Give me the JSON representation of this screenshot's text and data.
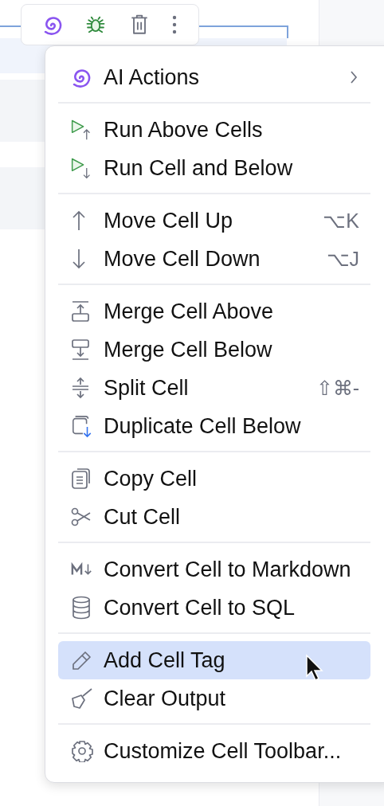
{
  "toolbar": {
    "buttons": [
      {
        "kind": "ai"
      },
      {
        "kind": "debug"
      },
      {
        "kind": "delete"
      },
      {
        "kind": "more"
      }
    ]
  },
  "menu": {
    "groups": [
      [
        {
          "kind": "ai",
          "label": "AI Actions",
          "submenu": true,
          "selected": false
        }
      ],
      [
        {
          "kind": "run-above",
          "label": "Run Above Cells",
          "submenu": false,
          "selected": false
        },
        {
          "kind": "run-below",
          "label": "Run Cell and Below",
          "submenu": false,
          "selected": false
        }
      ],
      [
        {
          "kind": "up",
          "label": "Move Cell Up",
          "shortcut": "⌥K",
          "submenu": false,
          "selected": false
        },
        {
          "kind": "down",
          "label": "Move Cell Down",
          "shortcut": "⌥J",
          "submenu": false,
          "selected": false
        }
      ],
      [
        {
          "kind": "merge-above",
          "label": "Merge Cell Above",
          "submenu": false,
          "selected": false
        },
        {
          "kind": "merge-below",
          "label": "Merge Cell Below",
          "submenu": false,
          "selected": false
        },
        {
          "kind": "split",
          "label": "Split Cell",
          "shortcut": "⇧⌘-",
          "submenu": false,
          "selected": false
        },
        {
          "kind": "duplicate",
          "label": "Duplicate Cell Below",
          "submenu": false,
          "selected": false
        }
      ],
      [
        {
          "kind": "copy",
          "label": "Copy Cell",
          "submenu": false,
          "selected": false
        },
        {
          "kind": "cut",
          "label": "Cut Cell",
          "submenu": false,
          "selected": false
        }
      ],
      [
        {
          "kind": "markdown",
          "label": "Convert Cell to Markdown",
          "submenu": false,
          "selected": false
        },
        {
          "kind": "sql",
          "label": "Convert Cell to SQL",
          "submenu": false,
          "selected": false
        }
      ],
      [
        {
          "kind": "tag",
          "label": "Add Cell Tag",
          "submenu": false,
          "selected": true
        },
        {
          "kind": "clear",
          "label": "Clear Output",
          "submenu": false,
          "selected": false
        }
      ],
      [
        {
          "kind": "settings",
          "label": "Customize Cell Toolbar...",
          "submenu": false,
          "selected": false
        }
      ]
    ]
  }
}
